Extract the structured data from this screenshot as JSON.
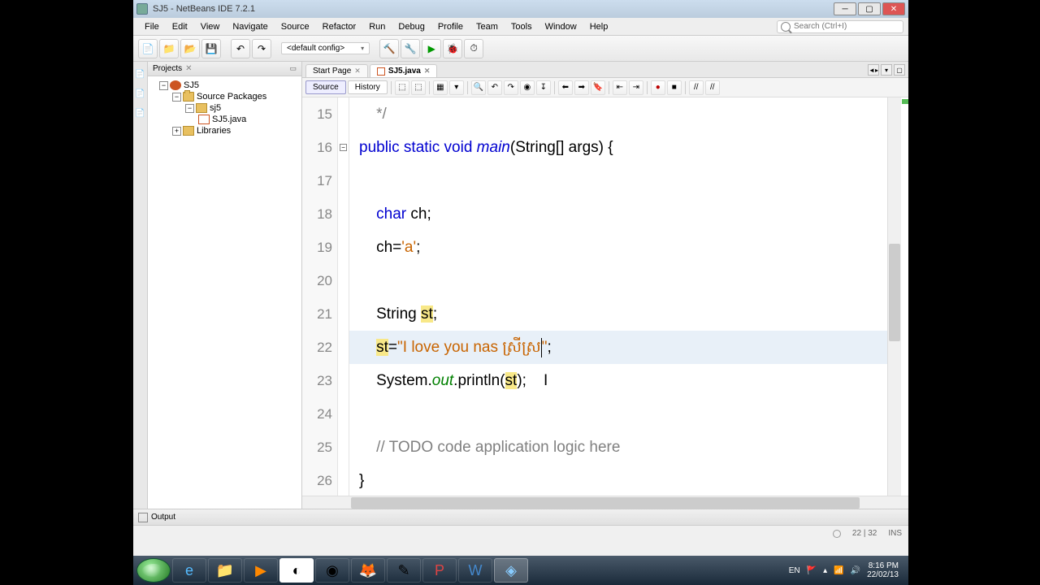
{
  "window": {
    "title": "SJ5 - NetBeans IDE 7.2.1"
  },
  "menu": [
    "File",
    "Edit",
    "View",
    "Navigate",
    "Source",
    "Refactor",
    "Run",
    "Debug",
    "Profile",
    "Team",
    "Tools",
    "Window",
    "Help"
  ],
  "search_placeholder": "Search (Ctrl+I)",
  "config_combo": "<default config>",
  "projects_panel": {
    "title": "Projects",
    "tree": {
      "root": "SJ5",
      "src_pkg": "Source Packages",
      "pkg": "sj5",
      "file": "SJ5.java",
      "libs": "Libraries"
    }
  },
  "left_rail": [
    "Projects",
    "Files",
    "Services"
  ],
  "editor_tabs": {
    "tab1": "Start Page",
    "tab2": "SJ5.java"
  },
  "editor_subtabs": {
    "source": "Source",
    "history": "History"
  },
  "code_lines": {
    "15": {
      "num": "15",
      "content": "    */"
    },
    "16": {
      "num": "16",
      "prefix": "",
      "kw1": "public static void",
      "method": " main",
      "args": "(String[] args) {"
    },
    "17": {
      "num": "17",
      "content": ""
    },
    "18": {
      "num": "18",
      "kw": "char",
      "rest": " ch;"
    },
    "19": {
      "num": "19",
      "prefix": "    ch=",
      "str": "'a'",
      "semi": ";"
    },
    "20": {
      "num": "20",
      "content": ""
    },
    "21": {
      "num": "21",
      "prefix": "    String ",
      "hl": "st",
      "semi": ";"
    },
    "22": {
      "num": "22",
      "hl1": "st",
      "eq": "=",
      "str": "\"I love you nas ស្រីស្រ",
      "caret": "|",
      "end": "\";"
    },
    "23": {
      "num": "23",
      "prefix": "    System.",
      "field": "out",
      "mid": ".println(",
      "hl": "st",
      "end": ");"
    },
    "24": {
      "num": "24",
      "content": ""
    },
    "25": {
      "num": "25",
      "cmt": "    // TODO code application logic here"
    },
    "26": {
      "num": "26",
      "content": "}"
    }
  },
  "output_label": "Output",
  "status": {
    "pos": "22 | 32",
    "ins": "INS"
  },
  "tray": {
    "lang": "EN",
    "time": "8:16 PM",
    "date": "22/02/13"
  }
}
